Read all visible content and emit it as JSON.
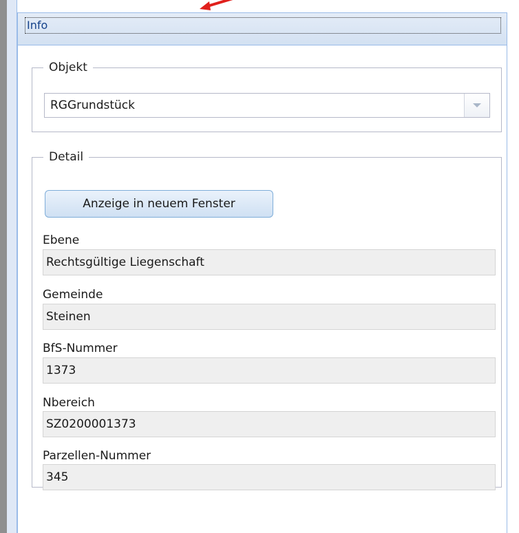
{
  "panel": {
    "title": "Info"
  },
  "objekt": {
    "legend": "Objekt",
    "selected": "RGGrundstück"
  },
  "detail": {
    "legend": "Detail",
    "button_label": "Anzeige in neuem Fenster",
    "fields": [
      {
        "label": "Ebene",
        "value": "Rechtsgültige Liegenschaft"
      },
      {
        "label": "Gemeinde",
        "value": "Steinen"
      },
      {
        "label": "BfS-Nummer",
        "value": "1373"
      },
      {
        "label": "Nbereich",
        "value": "SZ0200001373"
      },
      {
        "label": "Parzellen-Nummer",
        "value": "345"
      }
    ]
  },
  "colors": {
    "accent": "#99bbe8",
    "annotation_arrow": "#e0201c"
  }
}
